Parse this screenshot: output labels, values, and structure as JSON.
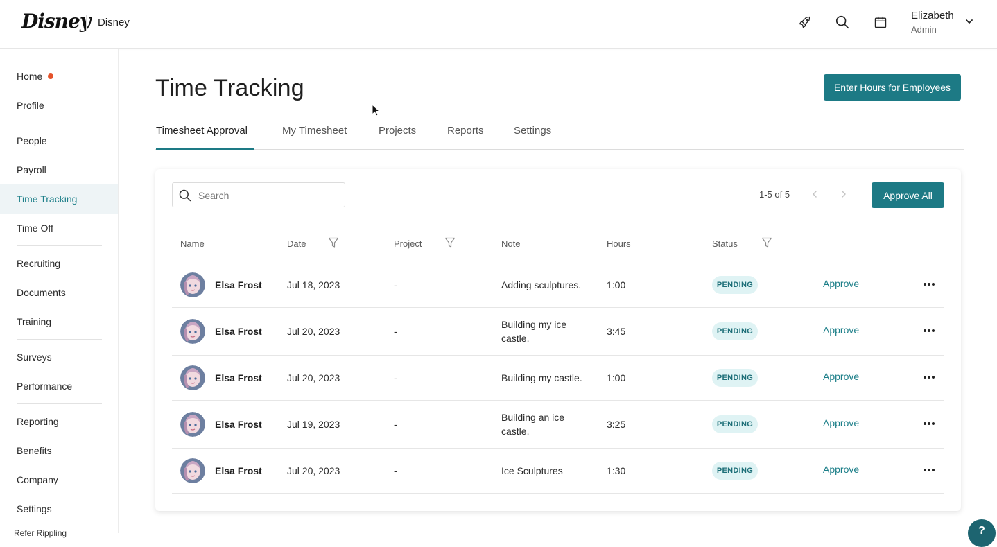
{
  "header": {
    "logo_text": "Disney",
    "company_name": "Disney",
    "icons": [
      "rocket-icon",
      "search-icon",
      "calendar-icon"
    ],
    "user": {
      "name": "Elizabeth",
      "role": "Admin"
    }
  },
  "sidebar": {
    "items": [
      {
        "label": "Home",
        "has_dot": true
      },
      {
        "label": "Profile"
      },
      {
        "label": "People"
      },
      {
        "label": "Payroll"
      },
      {
        "label": "Time Tracking",
        "active": true
      },
      {
        "label": "Time Off"
      },
      {
        "label": "Recruiting"
      },
      {
        "label": "Documents"
      },
      {
        "label": "Training"
      },
      {
        "label": "Surveys"
      },
      {
        "label": "Performance"
      },
      {
        "label": "Reporting"
      },
      {
        "label": "Benefits"
      },
      {
        "label": "Company"
      },
      {
        "label": "Settings"
      }
    ],
    "partial_item": "Refer Rippling"
  },
  "main": {
    "title": "Time Tracking",
    "enter_hours_button": "Enter Hours for Employees",
    "tabs": [
      {
        "label": "Timesheet Approval",
        "active": true
      },
      {
        "label": "My Timesheet"
      },
      {
        "label": "Projects"
      },
      {
        "label": "Reports"
      },
      {
        "label": "Settings"
      }
    ]
  },
  "table": {
    "search_placeholder": "Search",
    "pagination": "1-5 of 5",
    "approve_all_button": "Approve All",
    "columns": {
      "name": "Name",
      "date": "Date",
      "project": "Project",
      "note": "Note",
      "hours": "Hours",
      "status": "Status"
    },
    "rows": [
      {
        "name": "Elsa Frost",
        "date": "Jul 18, 2023",
        "project": "-",
        "note_line1": "Adding sculptures.",
        "note_line2": "",
        "hours": "1:00",
        "status": "PENDING",
        "action": "Approve"
      },
      {
        "name": "Elsa Frost",
        "date": "Jul 20, 2023",
        "project": "-",
        "note_line1": "Building my ice",
        "note_line2": "castle.",
        "hours": "3:45",
        "status": "PENDING",
        "action": "Approve"
      },
      {
        "name": "Elsa Frost",
        "date": "Jul 20, 2023",
        "project": "-",
        "note_line1": "Building my castle.",
        "note_line2": "",
        "hours": "1:00",
        "status": "PENDING",
        "action": "Approve"
      },
      {
        "name": "Elsa Frost",
        "date": "Jul 19, 2023",
        "project": "-",
        "note_line1": "Building an ice",
        "note_line2": "castle.",
        "hours": "3:25",
        "status": "PENDING",
        "action": "Approve"
      },
      {
        "name": "Elsa Frost",
        "date": "Jul 20, 2023",
        "project": "-",
        "note_line1": "Ice Sculptures",
        "note_line2": "",
        "hours": "1:30",
        "status": "PENDING",
        "action": "Approve"
      }
    ]
  },
  "help_button": "?",
  "colors": {
    "accent": "#1d7a85",
    "active_nav_bg": "#eef4f6",
    "badge_bg": "#dff3f4",
    "notification_dot": "#e5532b"
  }
}
